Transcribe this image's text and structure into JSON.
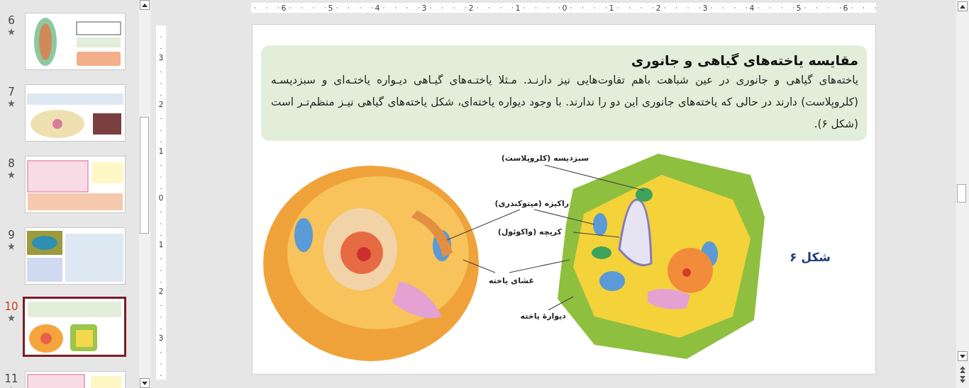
{
  "slides": [
    {
      "number": "6",
      "starred": true,
      "selected": false
    },
    {
      "number": "7",
      "starred": true,
      "selected": false
    },
    {
      "number": "8",
      "starred": true,
      "selected": false
    },
    {
      "number": "9",
      "starred": true,
      "selected": false
    },
    {
      "number": "10",
      "starred": true,
      "selected": true
    },
    {
      "number": "11",
      "starred": true,
      "selected": false
    }
  ],
  "horizontal_ruler": [
    "6",
    "5",
    "4",
    "3",
    "2",
    "1",
    "0",
    "1",
    "2",
    "3",
    "4",
    "5",
    "6"
  ],
  "vertical_ruler": [
    "3",
    "2",
    "1",
    "0",
    "1",
    "2",
    "3"
  ],
  "slide": {
    "title": "مقایسه یاخته‌های گیاهی و جانوری",
    "paragraph": "یاخته‌های گیاهی و جانوری در عین شباهت باهم تفاوت‌هایی نیز دارنـد. مـثلا یاختـه‌های گیـاهی دیـواره یاختـه‌ای و سبزدیسـه (کلروپلاست) دارند در حالی که یاخته‌های جانوری این دو را ندارند. با وجود دیواره یاخته‌ای، شکل یاخته‌های گیاهی نیـز منظم‌تـر است (شکل ۶).",
    "figure_labels": [
      "سبزدیسه (کلروپلاست)",
      "راکیزه (میتوکندری)",
      "کریچه (واکوئول)",
      "غشای یاخته",
      "دیوارهٔ یاخته"
    ],
    "figure_caption": "شکل ۶"
  }
}
